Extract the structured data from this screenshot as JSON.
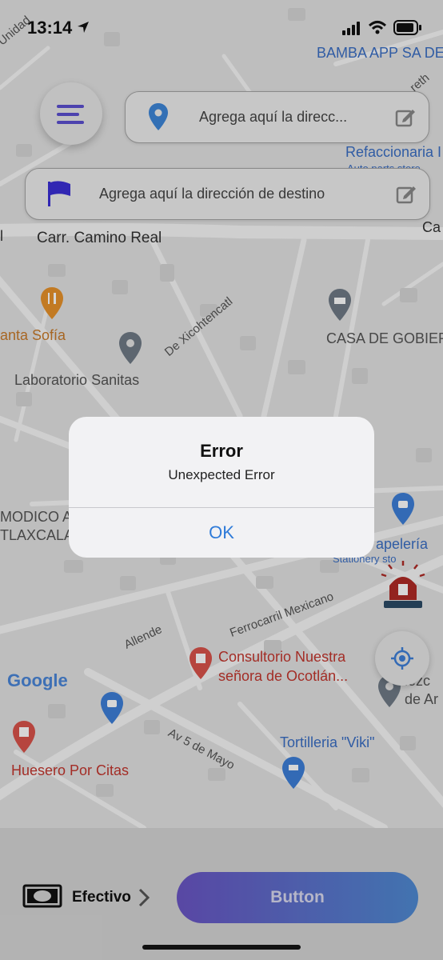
{
  "status_bar": {
    "time": "13:14"
  },
  "search": {
    "origin_placeholder": "Agrega aquí la direcc...",
    "destination_placeholder": "Agrega aquí la dirección de destino"
  },
  "map": {
    "labels": {
      "bamba": "BAMBA APP SA DE",
      "refaccionaria": "Refaccionaria I",
      "auto_parts": "Auto parts store",
      "carr_camino_real": "Carr. Camino Real",
      "santa_sofia": "anta Sofía",
      "laboratorio": "Laboratorio Sanitas",
      "xicohtencatl": "De Xicohtencatl",
      "casa_gobierno": "CASA DE GOBIER",
      "modico": "MODICO AI",
      "tlaxcala": "TLAXCALA",
      "papeleria": "apelería",
      "stationery": "Stationery sto",
      "ferrocarril": "Ferrocarril Mexicano",
      "allende": "Allende",
      "consultorio_1": "Consultorio Nuestra",
      "consultorio_2": "señora de Ocotlán...",
      "google": "Google",
      "huesero": "Huesero Por Citas",
      "av5mayo": "Av 5 de Mayo",
      "tortilleria": "Tortilleria \"Viki\"",
      "right_label_1": "iezc",
      "right_label_2": "de Ar",
      "unidad": "Unidad",
      "ca": "Ca",
      "l": "l",
      "reth": "reth"
    }
  },
  "alert": {
    "title": "Error",
    "message": "Unexpected Error",
    "ok_label": "OK"
  },
  "bottom": {
    "payment_label": "Efectivo",
    "button_label": "Button"
  },
  "colors": {
    "accent_purple": "#6a55c4",
    "accent_blue": "#4f8ad2",
    "ok_blue": "#2f7bd9",
    "flag_blue": "#3b2fd6"
  }
}
